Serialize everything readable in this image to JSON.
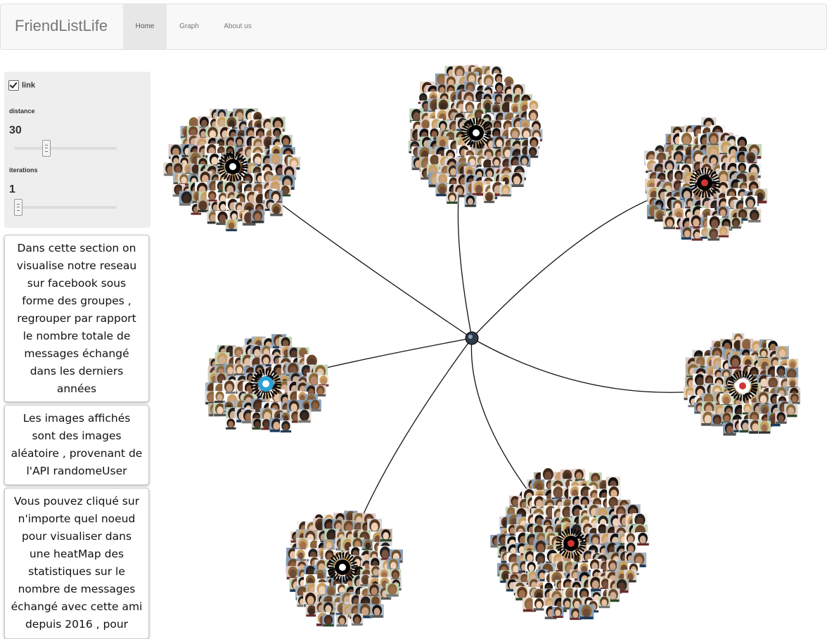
{
  "navbar": {
    "brand": "FriendListLife",
    "items": [
      {
        "label": "Home",
        "active": true
      },
      {
        "label": "Graph",
        "active": false
      },
      {
        "label": "About us",
        "active": false
      }
    ]
  },
  "controls": {
    "link_label": "link",
    "link_checked": true,
    "distance_label": "distance",
    "distance_value": "30",
    "distance_fraction": 0.3,
    "iterations_label": "iterations",
    "iterations_value": "1",
    "iterations_fraction": 0.0
  },
  "info_boxes": [
    "Dans cette section on visualise notre reseau sur facebook sous forme des groupes , regrouper par rapport le nombre totale de messages échangé dans les derniers années",
    "Les images affichés sont des images aléatoire , provenant de l'API randomeUser",
    "Vous pouvez cliqué sur n'importe quel noeud pour visualiser dans une heatMap des statistiques sur le nombre de messages échangé avec cette ami depuis 2016 , pour"
  ],
  "graph": {
    "colors": {
      "link": "#111111",
      "hub": "#2e3a4a",
      "accent_blue": "#2aa1d6",
      "accent_red": "#d33333"
    },
    "group_icons": [
      "soccer-ball-icon",
      "soccer-ball-icon",
      "shield-emblem-icon",
      "users-group-icon",
      "home-icon",
      "soccer-ball-icon",
      "shield-emblem-icon"
    ]
  }
}
